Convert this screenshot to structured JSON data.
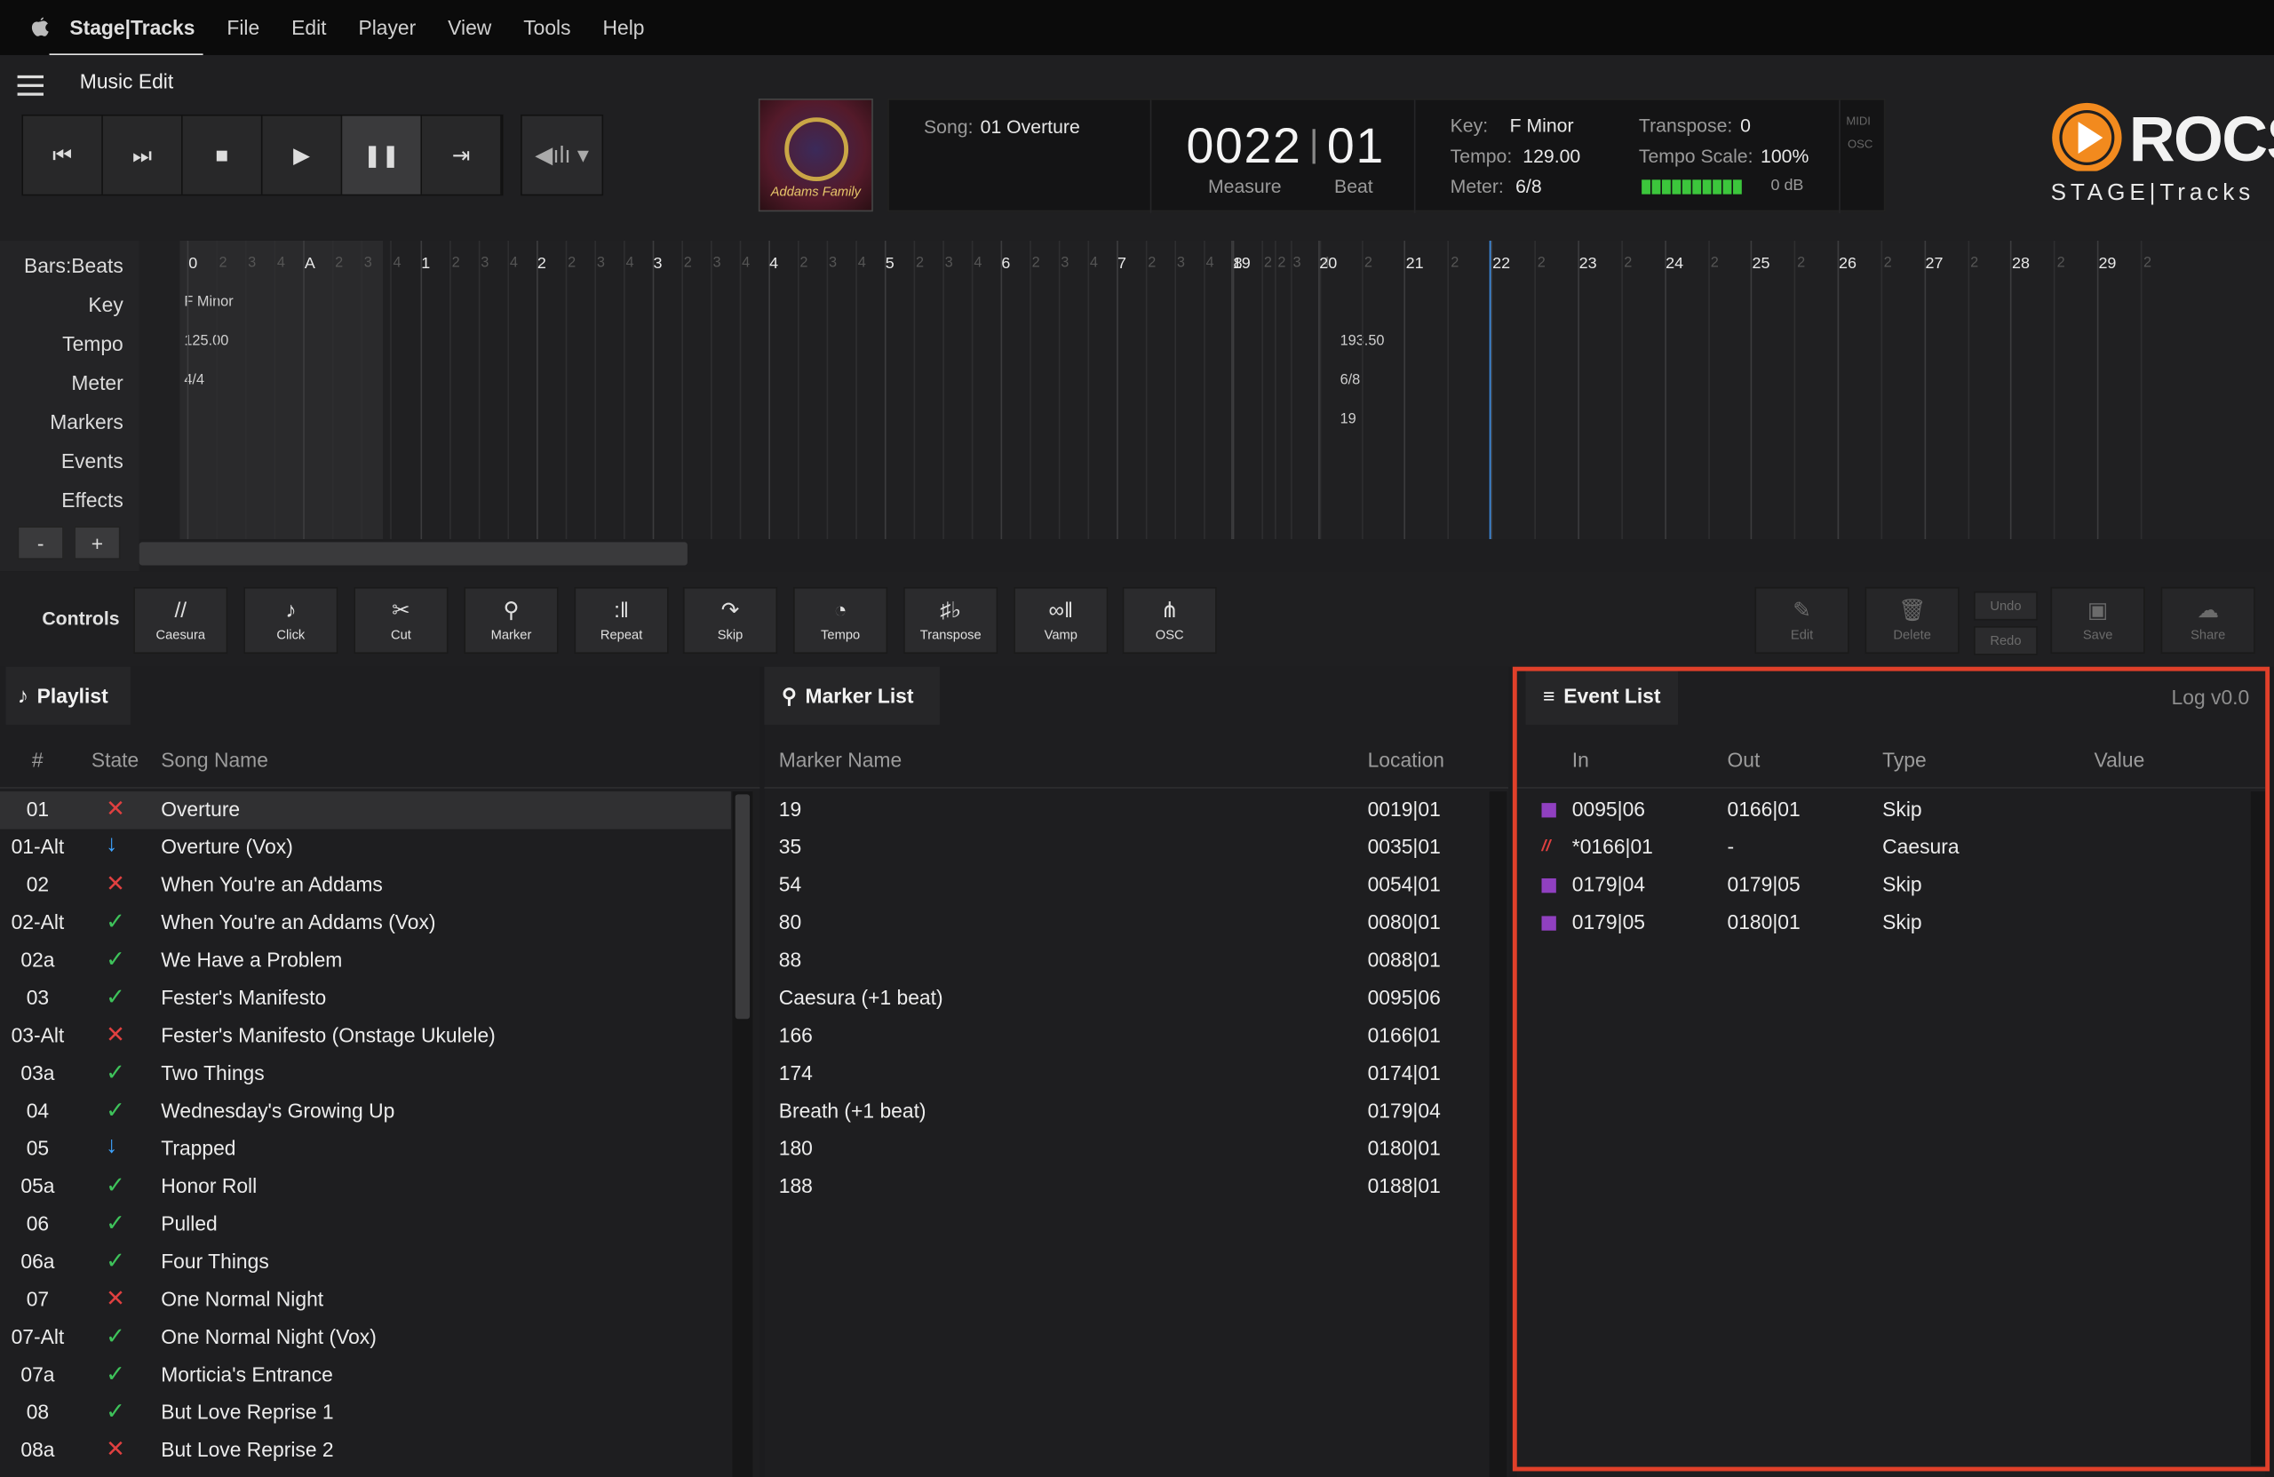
{
  "menubar": {
    "app": "Stage|Tracks",
    "items": [
      "File",
      "Edit",
      "Player",
      "View",
      "Tools",
      "Help"
    ]
  },
  "header": {
    "title": "Music Edit"
  },
  "transport": {
    "buttons": [
      "skip-back-icon",
      "skip-forward-icon",
      "stop-icon",
      "play-icon",
      "pause-icon",
      "skip-to-end-icon"
    ],
    "volume": "volume-icon"
  },
  "album_art": {
    "caption": "Addams Family"
  },
  "info": {
    "song_label": "Song:",
    "song": "01 Overture",
    "measure": "0022",
    "beat": "01",
    "measure_label": "Measure",
    "beat_label": "Beat",
    "key_label": "Key:",
    "key": "F Minor",
    "tempo_label": "Tempo:",
    "tempo": "129.00",
    "meter_label": "Meter:",
    "meter": "6/8",
    "transpose_label": "Transpose:",
    "transpose": "0",
    "tempo_scale_label": "Tempo Scale:",
    "tempo_scale": "100%",
    "level": "0 dB",
    "midi": "MIDI",
    "osc": "OSC",
    "level_segments": 10
  },
  "logo": {
    "name": "ROCS",
    "sub": "STAGE|Tracks",
    "accent": "#f28a1e"
  },
  "timeline": {
    "row_labels": [
      "Bars:Beats",
      "Key",
      "Tempo",
      "Meter",
      "Markers",
      "Events",
      "Effects"
    ],
    "bars_a": [
      "0",
      "A",
      "1",
      "2",
      "3",
      "4",
      "5",
      "6",
      "7",
      "8"
    ],
    "bars_b": [
      "19",
      "20",
      "21",
      "22",
      "23",
      "24",
      "25",
      "26",
      "27",
      "28",
      "29"
    ],
    "beat_numbers": [
      "2",
      "3",
      "4"
    ],
    "key_start": "F Minor",
    "tempo_start": "125.00",
    "meter_start": "4/4",
    "tempo_19": "193.50",
    "meter_19": "6/8",
    "marker_19": "19",
    "zoom_minus": "-",
    "zoom_plus": "+"
  },
  "controls": {
    "label": "Controls",
    "buttons": [
      {
        "label": "Caesura",
        "icon": "//"
      },
      {
        "label": "Click",
        "icon": "♪"
      },
      {
        "label": "Cut",
        "icon": "✂"
      },
      {
        "label": "Marker",
        "icon": "⚲"
      },
      {
        "label": "Repeat",
        "icon": ":‖"
      },
      {
        "label": "Skip",
        "icon": "↷"
      },
      {
        "label": "Tempo",
        "icon": "◔"
      },
      {
        "label": "Transpose",
        "icon": "♯♭"
      },
      {
        "label": "Vamp",
        "icon": "∞‖"
      },
      {
        "label": "OSC",
        "icon": "⋔"
      }
    ],
    "edit": "Edit",
    "delete": "Delete",
    "undo": "Undo",
    "redo": "Redo",
    "save": "Save",
    "share": "Share"
  },
  "playlist": {
    "title": "Playlist",
    "cols": {
      "num": "#",
      "state": "State",
      "name": "Song Name"
    },
    "rows": [
      {
        "num": "01",
        "state": "x",
        "name": "Overture"
      },
      {
        "num": "01-Alt",
        "state": "down",
        "name": "Overture (Vox)"
      },
      {
        "num": "02",
        "state": "x",
        "name": "When You're an Addams"
      },
      {
        "num": "02-Alt",
        "state": "ok",
        "name": "When You're an Addams (Vox)"
      },
      {
        "num": "02a",
        "state": "ok",
        "name": "We Have a Problem"
      },
      {
        "num": "03",
        "state": "ok",
        "name": "Fester's Manifesto"
      },
      {
        "num": "03-Alt",
        "state": "x",
        "name": "Fester's Manifesto (Onstage Ukulele)"
      },
      {
        "num": "03a",
        "state": "ok",
        "name": "Two Things"
      },
      {
        "num": "04",
        "state": "ok",
        "name": "Wednesday's Growing Up"
      },
      {
        "num": "05",
        "state": "down",
        "name": "Trapped"
      },
      {
        "num": "05a",
        "state": "ok",
        "name": "Honor Roll"
      },
      {
        "num": "06",
        "state": "ok",
        "name": "Pulled"
      },
      {
        "num": "06a",
        "state": "ok",
        "name": "Four Things"
      },
      {
        "num": "07",
        "state": "x",
        "name": "One Normal Night"
      },
      {
        "num": "07-Alt",
        "state": "ok",
        "name": "One Normal Night (Vox)"
      },
      {
        "num": "07a",
        "state": "ok",
        "name": "Morticia's Entrance"
      },
      {
        "num": "08",
        "state": "ok",
        "name": "But Love Reprise 1"
      },
      {
        "num": "08a",
        "state": "x",
        "name": "But Love Reprise 2"
      }
    ]
  },
  "markers": {
    "title": "Marker List",
    "cols": {
      "name": "Marker Name",
      "location": "Location"
    },
    "rows": [
      {
        "name": "19",
        "location": "0019|01"
      },
      {
        "name": "35",
        "location": "0035|01"
      },
      {
        "name": "54",
        "location": "0054|01"
      },
      {
        "name": "80",
        "location": "0080|01"
      },
      {
        "name": "88",
        "location": "0088|01"
      },
      {
        "name": "Caesura (+1 beat)",
        "location": "0095|06"
      },
      {
        "name": "166",
        "location": "0166|01"
      },
      {
        "name": "174",
        "location": "0174|01"
      },
      {
        "name": "Breath (+1 beat)",
        "location": "0179|04"
      },
      {
        "name": "180",
        "location": "0180|01"
      },
      {
        "name": "188",
        "location": "0188|01"
      }
    ]
  },
  "events": {
    "title": "Event List",
    "log": "Log v0.0",
    "cols": {
      "in": "In",
      "out": "Out",
      "type": "Type",
      "value": "Value"
    },
    "rows": [
      {
        "kind": "square",
        "in": "0095|06",
        "out": "0166|01",
        "type": "Skip",
        "value": ""
      },
      {
        "kind": "caesura",
        "in": "*0166|01",
        "out": "-",
        "type": "Caesura",
        "value": ""
      },
      {
        "kind": "square",
        "in": "0179|04",
        "out": "0179|05",
        "type": "Skip",
        "value": ""
      },
      {
        "kind": "square",
        "in": "0179|05",
        "out": "0180|01",
        "type": "Skip",
        "value": ""
      }
    ]
  }
}
